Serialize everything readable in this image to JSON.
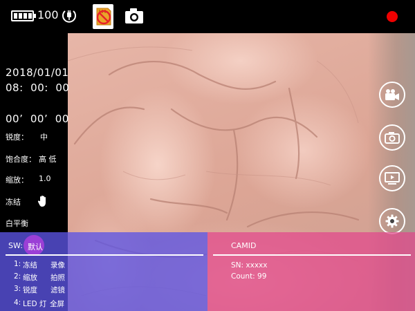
{
  "status_bar": {
    "battery_level": "100",
    "battery_icon": "battery-full-icon",
    "power_icon": "plug-icon",
    "storage_icon": "sd-card-missing-icon",
    "capture_icon": "camera-icon",
    "record_indicator_icon": "recording-dot-icon",
    "record_color": "#e60000"
  },
  "info": {
    "date": "2018/01/01",
    "time": "08:  00:  00",
    "elapsed": "00’  00’  00",
    "sharpness_label": "锐度：",
    "sharpness_value": "中",
    "saturation_label": "饱合度：",
    "saturation_value": "高 低",
    "zoom_label": "缩放：",
    "zoom_value": "1.0",
    "freeze_label": "冻结",
    "freeze_icon": "hand-icon",
    "white_balance_label": "白平衡"
  },
  "side_buttons": [
    {
      "icon": "video-camera-icon"
    },
    {
      "icon": "camera-icon"
    },
    {
      "icon": "playback-icon"
    },
    {
      "icon": "settings-gear-icon"
    }
  ],
  "sw_panel": {
    "label": "SW:",
    "value": "默认",
    "menu": [
      {
        "num": "1:",
        "left": "冻结",
        "right": "录像"
      },
      {
        "num": "2:",
        "left": "缩放",
        "right": "拍照"
      },
      {
        "num": "3:",
        "left": "锐度",
        "right": "滤镜"
      },
      {
        "num": "4:",
        "left": "LED 灯",
        "right": "全屏"
      }
    ],
    "color": "#5c54e4"
  },
  "cam_panel": {
    "title": "CAMID",
    "sn": "SN: xxxxx",
    "count": "Count: 99",
    "color": "#e2468c"
  }
}
